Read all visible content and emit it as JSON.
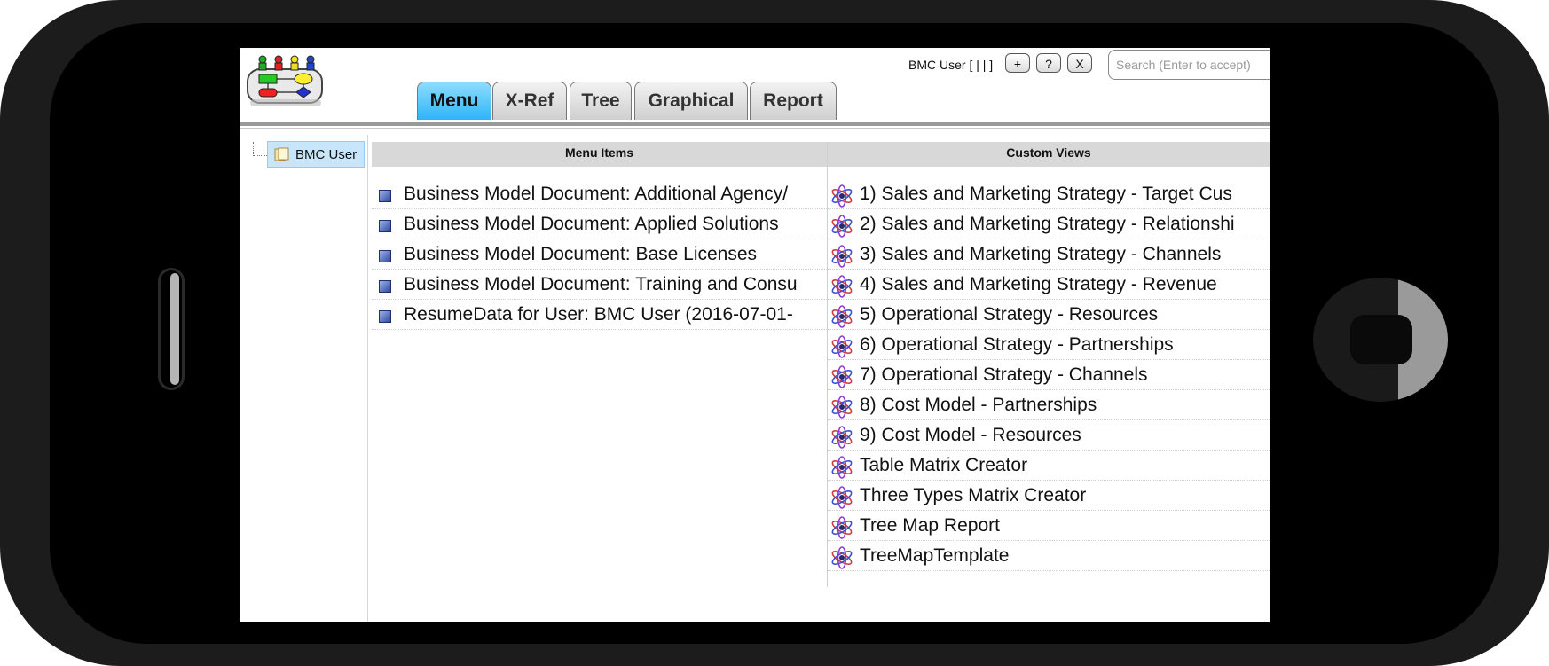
{
  "header": {
    "user_label": "BMC User [ | | ]",
    "buttons": [
      {
        "label": "+",
        "name": "add-button"
      },
      {
        "label": "?",
        "name": "help-button"
      },
      {
        "label": "X",
        "name": "close-button"
      }
    ],
    "search_placeholder": "Search (Enter to accept)"
  },
  "tabs": [
    {
      "label": "Menu",
      "active": true
    },
    {
      "label": "X-Ref",
      "active": false
    },
    {
      "label": "Tree",
      "active": false
    },
    {
      "label": "Graphical",
      "active": false
    },
    {
      "label": "Report",
      "active": false
    }
  ],
  "tree": {
    "root_label": "BMC User"
  },
  "menu_items": {
    "header": "Menu Items",
    "items": [
      "Business Model Document: Additional Agency/",
      "Business Model Document: Applied Solutions",
      "Business Model Document: Base Licenses",
      "Business Model Document: Training and Consu",
      "ResumeData for User: BMC User (2016-07-01-"
    ]
  },
  "custom_views": {
    "header": "Custom Views",
    "items": [
      "1) Sales and Marketing Strategy - Target Cus",
      "2) Sales and Marketing Strategy - Relationshi",
      "3) Sales and Marketing Strategy - Channels",
      "4) Sales and Marketing Strategy - Revenue",
      "5) Operational Strategy - Resources",
      "6) Operational Strategy - Partnerships",
      "7) Operational Strategy - Channels",
      "8) Cost Model - Partnerships",
      "9) Cost Model - Resources",
      "Table Matrix Creator",
      "Three Types Matrix Creator",
      "Tree Map Report",
      "TreeMapTemplate"
    ]
  },
  "colors": {
    "active_tab": "#2cb6f5",
    "tree_selected": "#c7e6fb",
    "header_bg": "#d8d8d8"
  },
  "icons": {
    "menu_item": "blue-square-icon",
    "custom_view": "atom-icon",
    "tree_node": "folder-icon",
    "logo": "app-logo-flowchart"
  }
}
